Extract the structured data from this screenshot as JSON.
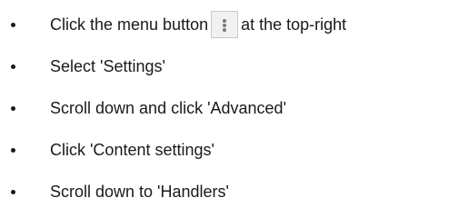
{
  "steps": [
    {
      "before": "Click the menu button",
      "icon": "vertical-dots-menu-icon",
      "after": "at the top-right"
    },
    {
      "text": "Select 'Settings'"
    },
    {
      "text": "Scroll down and click 'Advanced'"
    },
    {
      "text": "Click 'Content settings'"
    },
    {
      "text": "Scroll down to 'Handlers'"
    }
  ]
}
